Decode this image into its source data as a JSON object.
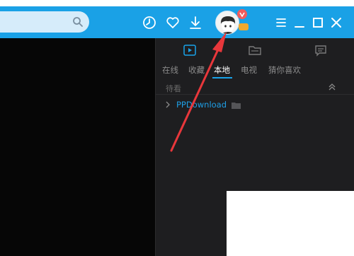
{
  "colors": {
    "titlebar": "#1aa1e6",
    "search_bg": "#d6ecfa",
    "video_bg": "#060606",
    "panel_bg": "#1e1e20",
    "accent": "#19a3e9",
    "folder_text": "#1f9fe6",
    "annotation_arrow": "#e8373b"
  },
  "titlebar": {
    "icons": [
      "search-icon",
      "history-icon",
      "heart-icon",
      "download-icon",
      "avatar",
      "menu-icon",
      "minimize-icon",
      "maximize-icon",
      "close-icon"
    ]
  },
  "panel": {
    "icons": [
      "video-list-icon",
      "folder-icon",
      "chat-icon"
    ],
    "tabs": [
      {
        "label": "在线",
        "active": false
      },
      {
        "label": "收藏",
        "active": false
      },
      {
        "label": "本地",
        "active": true
      },
      {
        "label": "电视",
        "active": false
      },
      {
        "label": "猜你喜欢",
        "active": false
      }
    ],
    "section_label": "待看",
    "folder_name": "PPDownload"
  },
  "annotation": {
    "type": "red-arrow",
    "points_to": "avatar"
  }
}
